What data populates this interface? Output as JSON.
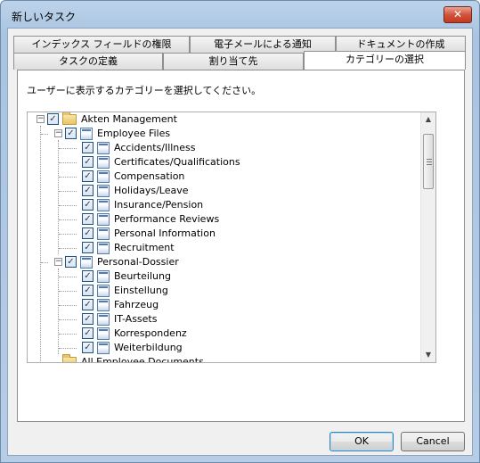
{
  "window": {
    "title": "新しいタスク",
    "close_glyph": "✕"
  },
  "tabs": {
    "row_back": [
      {
        "label": "インデックス フィールドの権限"
      },
      {
        "label": "電子メールによる通知"
      },
      {
        "label": "ドキュメントの作成"
      }
    ],
    "row_front": [
      {
        "label": "タスクの定義"
      },
      {
        "label": "割り当て先"
      },
      {
        "label": "カテゴリーの選択",
        "active": true
      }
    ]
  },
  "panel": {
    "instruction": "ユーザーに表示するカテゴリーを選択してください。"
  },
  "tree": {
    "root": {
      "label": "Akten Management",
      "expander": "−",
      "checked": "✓",
      "icon": "folder-icon"
    },
    "group1": {
      "label": "Employee Files",
      "expander": "−",
      "checked": "✓",
      "icon": "document-icon"
    },
    "group1_items": [
      {
        "label": "Accidents/Illness"
      },
      {
        "label": "Certificates/Qualifications"
      },
      {
        "label": "Compensation"
      },
      {
        "label": "Holidays/Leave"
      },
      {
        "label": "Insurance/Pension"
      },
      {
        "label": "Performance Reviews"
      },
      {
        "label": "Personal Information"
      },
      {
        "label": "Recruitment"
      }
    ],
    "group2": {
      "label": "Personal-Dossier",
      "expander": "−",
      "checked": "✓",
      "icon": "document-icon"
    },
    "group2_items": [
      {
        "label": "Beurteilung"
      },
      {
        "label": "Einstellung"
      },
      {
        "label": "Fahrzeug"
      },
      {
        "label": "IT-Assets"
      },
      {
        "label": "Korrespondenz"
      },
      {
        "label": "Weiterbildung"
      }
    ],
    "partial_root": {
      "label": "All Employee Documents"
    },
    "item_check": "✓",
    "scroll_up": "▲",
    "scroll_down": "▼"
  },
  "buttons": {
    "ok": "OK",
    "cancel": "Cancel"
  },
  "colors": {
    "title_gradient": "#bcd3ea",
    "close_red": "#c4391f",
    "check_border": "#1c5180",
    "default_button_border": "#3c7fb1"
  }
}
